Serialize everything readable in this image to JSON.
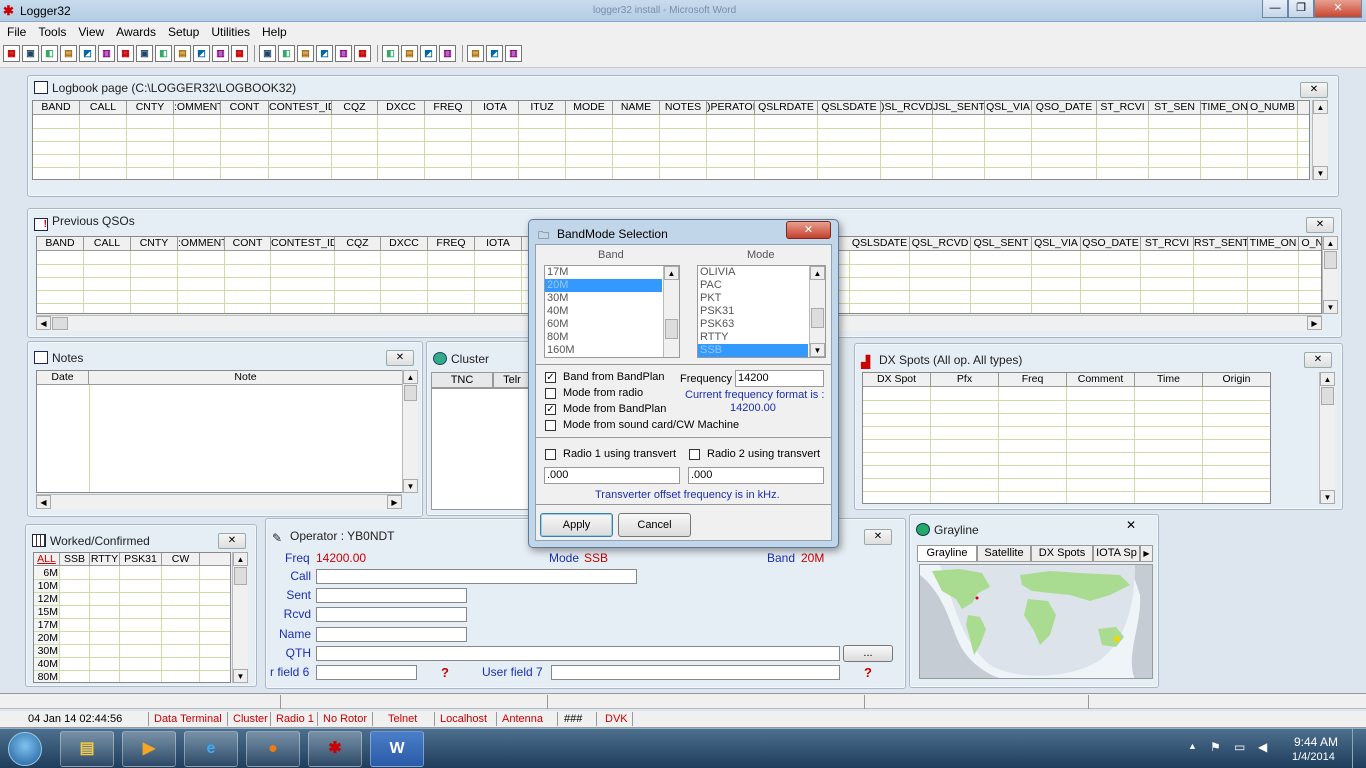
{
  "window": {
    "title": "Logger32",
    "background_title": "logger32 install - Microsoft Word"
  },
  "menu": [
    "File",
    "Tools",
    "View",
    "Awards",
    "Setup",
    "Utilities",
    "Help"
  ],
  "toolbar": {
    "groups": [
      [
        "logbook-icon",
        "previous-qsos-icon",
        "grayline-icon",
        "notes-icon",
        "worked-icon",
        "band-icon",
        "cluster-icon",
        "globe-icon",
        "grid-icon",
        "photo-icon",
        "graph-icon",
        "radio-icon",
        "text-icon"
      ],
      [
        "table-icon",
        "image-icon",
        "fn-icon",
        "calc-icon",
        "world-icon",
        "pie-icon"
      ],
      [
        "db-icon",
        "calendar-icon",
        "clock-icon",
        "target-icon"
      ],
      [
        "setup-icon",
        "tuner-icon",
        "arrow-icon"
      ]
    ]
  },
  "logbook": {
    "title": "Logbook page (C:\\LOGGER32\\LOGBOOK32)",
    "columns": [
      "BAND",
      "CALL",
      "CNTY",
      "COMMENT",
      "CONT",
      "CONTEST_ID",
      "CQZ",
      "DXCC",
      "FREQ",
      "IOTA",
      "ITUZ",
      "MODE",
      "NAME",
      "NOTES",
      "OPERATOR",
      "QSLRDATE",
      "QSLSDATE",
      "QSL_RCVD",
      "QSL_SENT",
      "QSL_VIA",
      "QSO_DATE",
      "RST_RCVD",
      "RST_SENT",
      "TIME_ON",
      "QSO_NUMB"
    ],
    "column_text": [
      "BAND",
      "CALL",
      "CNTY",
      ":OMMENT",
      "CONT",
      "CONTEST_ID",
      "CQZ",
      "DXCC",
      "FREQ",
      "IOTA",
      "ITUZ",
      "MODE",
      "NAME",
      "NOTES",
      ")PERATOR",
      "QSLRDATE",
      "QSLSDATE",
      ")SL_RCVD",
      "JSL_SENT",
      "QSL_VIA",
      "QSO_DATE",
      "ST_RCVI",
      "ST_SEN",
      "TIME_ON",
      "O_NUMB"
    ]
  },
  "previous": {
    "title": "Previous QSOs",
    "left_cols": [
      "BAND",
      "CALL",
      "CNTY",
      ":OMMENT",
      "CONT",
      "CONTEST_ID",
      "CQZ",
      "DXCC",
      "FREQ",
      "IOTA"
    ],
    "right_cols": [
      "QSLSDATE",
      "QSL_RCVD",
      "QSL_SENT",
      "QSL_VIA",
      "QSO_DATE",
      "ST_RCVI",
      "RST_SENT",
      "TIME_ON",
      "O_NUI"
    ]
  },
  "notes": {
    "title": "Notes",
    "col_date": "Date",
    "col_note": "Note"
  },
  "cluster": {
    "title": "Cluster",
    "tabs": [
      "TNC",
      "Telr"
    ]
  },
  "dxspots": {
    "title": "DX Spots (All op. All types)",
    "columns": [
      "DX Spot",
      "Pfx",
      "Freq",
      "Comment",
      "Time",
      "Origin"
    ]
  },
  "dialog": {
    "title": "BandMode Selection",
    "band_label": "Band",
    "mode_label": "Mode",
    "bands": [
      "17M",
      "20M",
      "30M",
      "40M",
      "60M",
      "80M",
      "160M"
    ],
    "band_selected": "20M",
    "modes": [
      "OLIVIA",
      "PAC",
      "PKT",
      "PSK31",
      "PSK63",
      "RTTY",
      "SSB"
    ],
    "mode_selected": "SSB",
    "checks": [
      {
        "label": "Band from BandPlan",
        "checked": true
      },
      {
        "label": "Mode from radio",
        "checked": false
      },
      {
        "label": "Mode from BandPlan",
        "checked": true
      },
      {
        "label": "Mode from sound card/CW Machine",
        "checked": false
      }
    ],
    "frequency_label": "Frequency",
    "frequency_value": "14200",
    "format_note_1": "Current frequency format is :",
    "format_note_2": "14200.00",
    "radio1_label": "Radio 1 using transvert",
    "radio1_checked": false,
    "radio2_label": "Radio 2 using transvert",
    "radio2_checked": false,
    "radio1_offset": ".000",
    "radio2_offset": ".000",
    "offset_note": "Transverter offset frequency is in kHz.",
    "apply": "Apply",
    "cancel": "Cancel",
    "checkmark": "✓"
  },
  "worked": {
    "title": "Worked/Confirmed",
    "cols": [
      "ALL",
      "SSB",
      "RTTY",
      "PSK31",
      "CW"
    ],
    "bands": [
      "6M",
      "10M",
      "12M",
      "15M",
      "17M",
      "20M",
      "30M",
      "40M",
      "80M"
    ]
  },
  "operator": {
    "title": "Operator : YB0NDT",
    "freq_label": "Freq",
    "freq_value": "14200.00",
    "mode_label": "Mode",
    "mode_value": "SSB",
    "band_label": "Band",
    "band_value": "20M",
    "fields": [
      "Call",
      "Sent",
      "Rcvd",
      "Name",
      "QTH"
    ],
    "uf6": "r field 6",
    "uf7": "User field 7",
    "qmark": "?",
    "ellipsis": "..."
  },
  "grayline": {
    "title": "Grayline",
    "tabs": [
      "Grayline",
      "Satellite",
      "DX Spots",
      "IOTA Sp"
    ]
  },
  "status": [
    "04 Jan 14  02:44:56",
    "Data Terminal",
    "Cluster",
    "Radio 1",
    "No Rotor",
    "Telnet",
    "Localhost",
    "Antenna",
    "###",
    "DVK"
  ],
  "taskbar": {
    "time": "9:44 AM",
    "date": "1/4/2014"
  },
  "glyphs": {
    "close": "✕",
    "up": "▲",
    "down": "▼",
    "left": "◀",
    "right": "▶",
    "min": "—",
    "max": "❐"
  },
  "colors": {
    "accent_red": "#cc0000",
    "label_blue": "#1a30b0",
    "selection": "#3399ff"
  }
}
